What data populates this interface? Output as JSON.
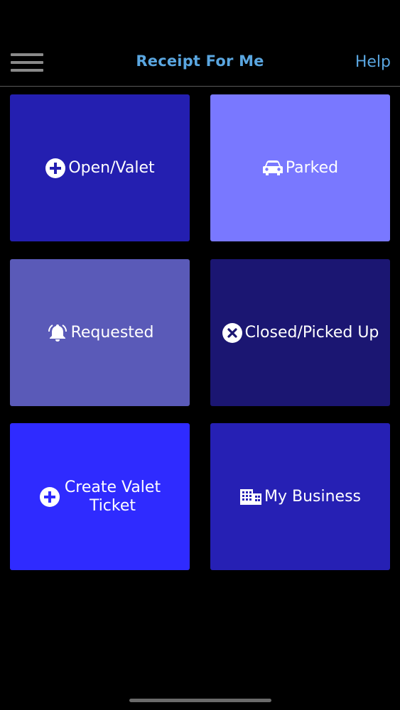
{
  "header": {
    "title": "Receipt For Me",
    "help_label": "Help",
    "menu_icon": "hamburger-menu-icon"
  },
  "tiles": [
    {
      "label": "Open/Valet",
      "icon": "plus-circle-icon",
      "color": "#241fb0"
    },
    {
      "label": "Parked",
      "icon": "car-icon",
      "color": "#7978ff"
    },
    {
      "label": "Requested",
      "icon": "bell-icon",
      "color": "#5a5ab8"
    },
    {
      "label": "Closed/Picked Up",
      "icon": "x-circle-icon",
      "color": "#1b1672"
    },
    {
      "label": "Create Valet\nTicket",
      "icon": "plus-circle-icon",
      "color": "#2f2bff"
    },
    {
      "label": "My Business",
      "icon": "building-icon",
      "color": "#2620b4"
    }
  ],
  "colors": {
    "background": "#000000",
    "accent": "#5aa6e0"
  }
}
